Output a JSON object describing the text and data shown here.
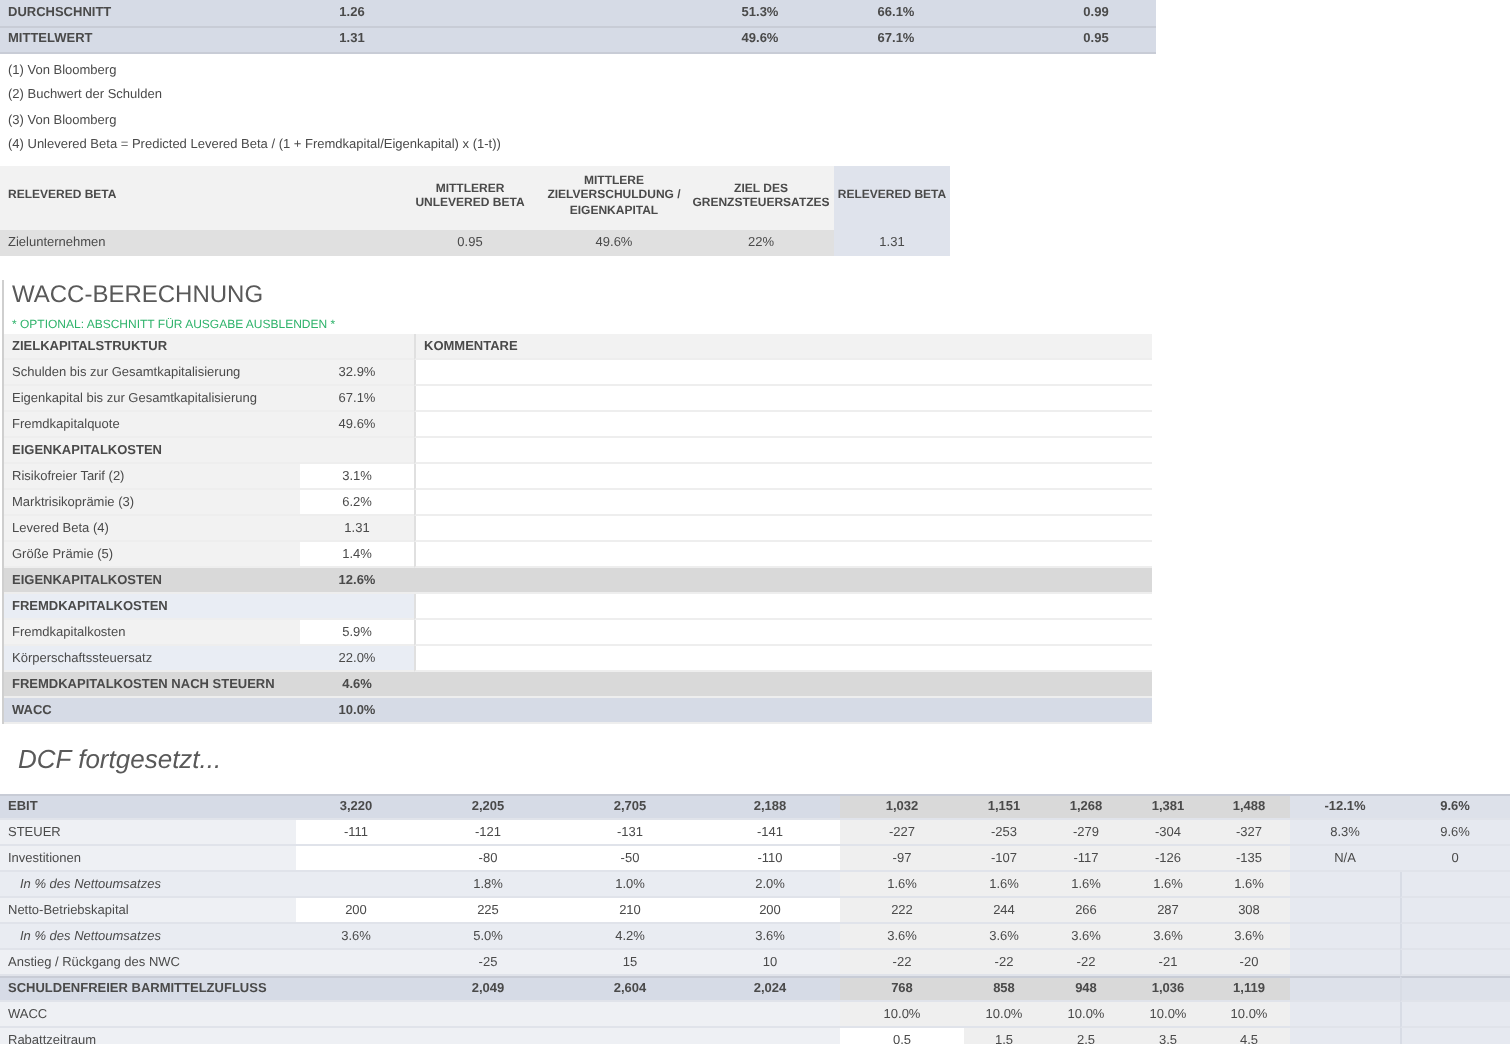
{
  "summary_rows": [
    {
      "label": "DURCHSCHNITT",
      "column_2": "1.26",
      "column_4": "51.3%",
      "column_5": "66.1%",
      "column_7": "0.99"
    },
    {
      "label": "MITTELWERT",
      "column_2": "1.31",
      "column_4": "49.6%",
      "column_5": "67.1%",
      "column_7": "0.95"
    }
  ],
  "footnotes": [
    "(1) Von Bloomberg",
    "(2) Buchwert der Schulden",
    "(3) Von Bloomberg",
    "(4) Unlevered Beta = Predicted Levered Beta / (1 + Fremdkapital/Eigenkapital) x (1-t))"
  ],
  "relevered_table": {
    "columns": [
      "RELEVERED BETA",
      "MITTLERER UNLEVERED BETA",
      "MITTLERE ZIELVERSCHULDUNG / EIGENKAPITAL",
      "ZIEL DES GRENZSTEUERSATZES",
      "RELEVERED BETA"
    ],
    "rows": [
      {
        "cells": [
          "Zielunternehmen",
          "0.95",
          "49.6%",
          "22%",
          "1.31"
        ]
      }
    ]
  },
  "wacc": {
    "title": "WACC-BERECHNUNG",
    "note": "* OPTIONAL: ABSCHNITT FÜR AUSGABE AUSBLENDEN *",
    "comments_header": "KOMMENTARE",
    "rows": [
      {
        "kind": "header",
        "label": "ZIELKAPITALSTRUKTUR"
      },
      {
        "kind": "item",
        "label": "Schulden bis zur Gesamtkapitalisierung",
        "value": "32.9%"
      },
      {
        "kind": "item",
        "label": "Eigenkapital bis zur Gesamtkapitalisierung",
        "value": "67.1%"
      },
      {
        "kind": "item",
        "label": "Fremdkapitalquote",
        "value": "49.6%"
      },
      {
        "kind": "section",
        "label": "EIGENKAPITALKOSTEN"
      },
      {
        "kind": "input",
        "label": "Risikofreier Tarif (2)",
        "value": "3.1%"
      },
      {
        "kind": "input",
        "label": "Marktrisikoprämie (3)",
        "value": "6.2%"
      },
      {
        "kind": "item",
        "label": "Levered Beta (4)",
        "value": "1.31"
      },
      {
        "kind": "input",
        "label": "Größe Prämie (5)",
        "value": "1.4%"
      },
      {
        "kind": "subtotal",
        "label": "EIGENKAPITALKOSTEN",
        "value": "12.6%"
      },
      {
        "kind": "section-blue",
        "label": "FREMDKAPITALKOSTEN"
      },
      {
        "kind": "input",
        "label": "Fremdkapitalkosten",
        "value": "5.9%"
      },
      {
        "kind": "item-blue",
        "label": "Körperschaftssteuersatz",
        "value": "22.0%"
      },
      {
        "kind": "subtotal",
        "label": "FREMDKAPITALKOSTEN NACH STEUERN",
        "value": "4.6%"
      },
      {
        "kind": "total",
        "label": "WACC",
        "value": "10.0%"
      }
    ]
  },
  "dcf": {
    "title": "DCF fortgesetzt...",
    "rows": [
      {
        "kind": "total",
        "label": "EBIT",
        "column_2": "3,220",
        "column_3": "2,205",
        "column_4": "2,705",
        "column_5": "2,188",
        "column_6": "1,032",
        "column_7": "1,151",
        "column_8": "1,268",
        "column_9": "1,381",
        "column_10": "1,488",
        "column_11": "-12.1%",
        "column_12": "9.6%"
      },
      {
        "kind": "input",
        "label": "STEUER",
        "column_2": "-111",
        "column_3": "-121",
        "column_4": "-131",
        "column_5": "-141",
        "column_6": "-227",
        "column_7": "-253",
        "column_8": "-279",
        "column_9": "-304",
        "column_10": "-327",
        "column_11": "8.3%",
        "column_12": "9.6%"
      },
      {
        "kind": "input",
        "label": "Investitionen",
        "column_3": "-80",
        "column_4": "-50",
        "column_5": "-110",
        "column_6": "-97",
        "column_7": "-107",
        "column_8": "-117",
        "column_9": "-126",
        "column_10": "-135",
        "column_11": "N/A",
        "column_12": "0"
      },
      {
        "kind": "percent",
        "label": "In % des Nettoumsatzes",
        "column_3": "1.8%",
        "column_4": "1.0%",
        "column_5": "2.0%",
        "column_6": "1.6%",
        "column_7": "1.6%",
        "column_8": "1.6%",
        "column_9": "1.6%",
        "column_10": "1.6%"
      },
      {
        "kind": "input",
        "label": "Netto-Betriebskapital",
        "column_2": "200",
        "column_3": "225",
        "column_4": "210",
        "column_5": "200",
        "column_6": "222",
        "column_7": "244",
        "column_8": "266",
        "column_9": "287",
        "column_10": "308"
      },
      {
        "kind": "percent",
        "label": "In % des Nettoumsatzes",
        "column_2": "3.6%",
        "column_3": "5.0%",
        "column_4": "4.2%",
        "column_5": "3.6%",
        "column_6": "3.6%",
        "column_7": "3.6%",
        "column_8": "3.6%",
        "column_9": "3.6%",
        "column_10": "3.6%"
      },
      {
        "kind": "plain",
        "label": "Anstieg / Rückgang des NWC",
        "column_3": "-25",
        "column_4": "15",
        "column_5": "10",
        "column_6": "-22",
        "column_7": "-22",
        "column_8": "-22",
        "column_9": "-21",
        "column_10": "-20"
      },
      {
        "kind": "total",
        "label": "SCHULDENFREIER BARMITTELZUFLUSS",
        "column_3": "2,049",
        "column_4": "2,604",
        "column_5": "2,024",
        "column_6": "768",
        "column_7": "858",
        "column_8": "948",
        "column_9": "1,036",
        "column_10": "1,119"
      },
      {
        "kind": "plain",
        "label": "WACC",
        "column_6": "10.0%",
        "column_7": "10.0%",
        "column_8": "10.0%",
        "column_9": "10.0%",
        "column_10": "10.0%"
      },
      {
        "kind": "period",
        "label": "Rabattzeitraum",
        "column_6": "0.5",
        "column_7": "1.5",
        "column_8": "2.5",
        "column_9": "3.5",
        "column_10": "4.5"
      }
    ]
  }
}
